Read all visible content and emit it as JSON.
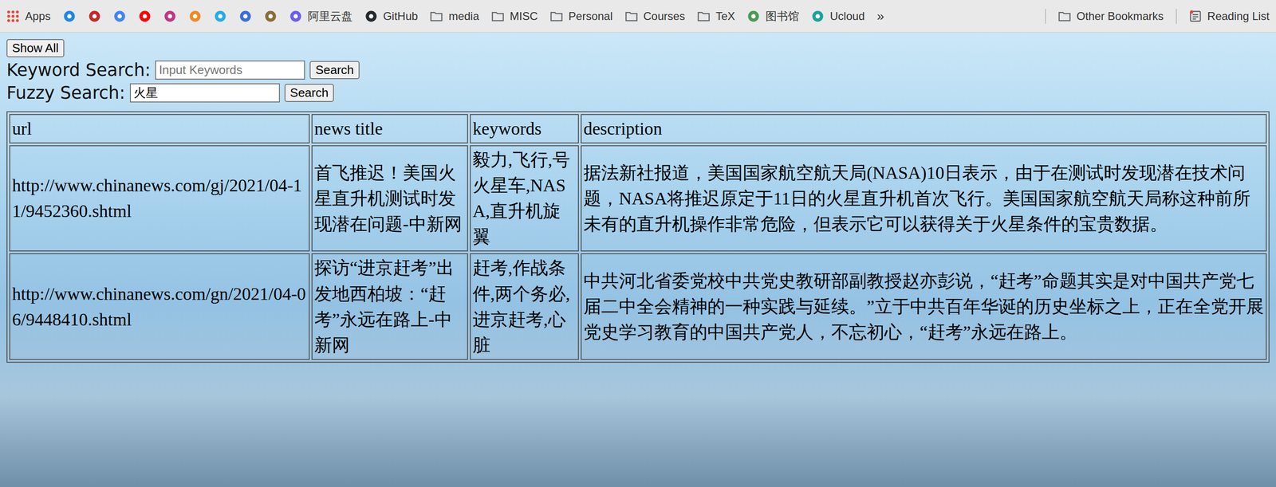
{
  "bookmarks": [
    {
      "label": "Apps",
      "kind": "apps",
      "color": "#e8453c"
    },
    {
      "label": "",
      "kind": "site",
      "color": "#1e88e5"
    },
    {
      "label": "",
      "kind": "site",
      "color": "#c62828"
    },
    {
      "label": "",
      "kind": "site",
      "color": "#4285f4"
    },
    {
      "label": "",
      "kind": "site",
      "color": "#ff0000"
    },
    {
      "label": "",
      "kind": "site",
      "color": "#c13584"
    },
    {
      "label": "",
      "kind": "site",
      "color": "#f08a24"
    },
    {
      "label": "",
      "kind": "site",
      "color": "#23ade5"
    },
    {
      "label": "",
      "kind": "site",
      "color": "#3b6fd8"
    },
    {
      "label": "",
      "kind": "site",
      "color": "#8a6d3b"
    },
    {
      "label": "阿里云盘",
      "kind": "site",
      "color": "#6a5cf0"
    },
    {
      "label": "GitHub",
      "kind": "site",
      "color": "#24292e"
    },
    {
      "label": "media",
      "kind": "folder",
      "color": "#5f6368"
    },
    {
      "label": "MISC",
      "kind": "folder",
      "color": "#5f6368"
    },
    {
      "label": "Personal",
      "kind": "folder",
      "color": "#5f6368"
    },
    {
      "label": "Courses",
      "kind": "folder",
      "color": "#5f6368"
    },
    {
      "label": "TeX",
      "kind": "folder",
      "color": "#5f6368"
    },
    {
      "label": "图书馆",
      "kind": "site",
      "color": "#4c9a55"
    },
    {
      "label": "Ucloud",
      "kind": "site",
      "color": "#1aa39a"
    }
  ],
  "overflow": "»",
  "other": [
    {
      "label": "Other Bookmarks",
      "kind": "folder",
      "color": "#5f6368"
    },
    {
      "label": "Reading List",
      "kind": "reading",
      "color": "#5f6368"
    }
  ],
  "page": {
    "show_all": "Show All",
    "keyword_search": {
      "label": "Keyword Search:",
      "placeholder": "Input Keywords",
      "value": "",
      "button": "Search"
    },
    "fuzzy_search": {
      "label": "Fuzzy Search:",
      "placeholder": "",
      "value": "火星",
      "button": "Search"
    }
  },
  "table": {
    "columns": [
      "url",
      "news title",
      "keywords",
      "description"
    ],
    "rows": [
      [
        "http://www.chinanews.com/gj/2021/04-11/9452360.shtml",
        "首飞推迟！美国火星直升机测试时发现潜在问题-中新网",
        "毅力,飞行,号火星车,NASA,直升机旋翼",
        "据法新社报道，美国国家航空航天局(NASA)10日表示，由于在测试时发现潜在技术问题，NASA将推迟原定于11日的火星直升机首次飞行。美国国家航空航天局称这种前所未有的直升机操作非常危险，但表示它可以获得关于火星条件的宝贵数据。"
      ],
      [
        "http://www.chinanews.com/gn/2021/04-06/9448410.shtml",
        "探访“进京赶考”出发地西柏坡：“赶考”永远在路上-中新网",
        "赶考,作战条件,两个务必,进京赶考,心脏",
        "中共河北省委党校中共党史教研部副教授赵亦彭说，“赶考”命题其实是对中国共产党七届二中全会精神的一种实践与延续。”立于中共百年华诞的历史坐标之上，正在全党开展党史学习教育的中国共产党人，不忘初心，“赶考”永远在路上。"
      ]
    ]
  }
}
